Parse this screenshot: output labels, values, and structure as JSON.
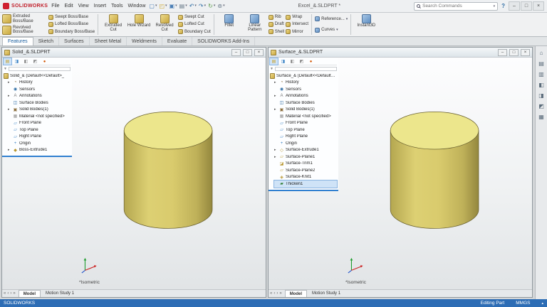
{
  "app": {
    "logo_text": "SOLIDWORKS",
    "menu": [
      "File",
      "Edit",
      "View",
      "Insert",
      "Tools",
      "Window"
    ],
    "qat": [
      {
        "name": "new-doc-icon",
        "glyph": "▢",
        "color": "#4a7eb5"
      },
      {
        "name": "open-icon",
        "glyph": "◰",
        "color": "#c9a227"
      },
      {
        "name": "save-icon",
        "glyph": "▣",
        "color": "#4a7eb5"
      },
      {
        "name": "print-icon",
        "glyph": "▤",
        "color": "#667788"
      },
      {
        "name": "undo-icon",
        "glyph": "↶",
        "color": "#2e6da4"
      },
      {
        "name": "redo-icon",
        "glyph": "↷",
        "color": "#2e6da4"
      },
      {
        "name": "rebuild-icon",
        "glyph": "↻",
        "color": "#5a9b4a"
      },
      {
        "name": "options-gear-icon",
        "glyph": "⊚",
        "color": "#667788"
      }
    ],
    "doc_title": "Excel_&.SLDPRT *",
    "search": {
      "placeholder": "Search Commands"
    },
    "help_label": "?",
    "window_buttons": {
      "minimize": "–",
      "maximize": "□",
      "close": "×"
    }
  },
  "ribbon": {
    "extruded_boss": "Extruded Boss/Base",
    "revolved_boss": "Revolved Boss/Base",
    "swept_boss": "Swept Boss/Base",
    "lofted_boss": "Lofted Boss/Base",
    "boundary_boss": "Boundary Boss/Base",
    "extruded_cut": "Extruded Cut",
    "hole_wizard": "Hole Wizard",
    "revolved_cut": "Revolved Cut",
    "swept_cut": "Swept Cut",
    "lofted_cut": "Lofted Cut",
    "boundary_cut": "Boundary Cut",
    "fillet": "Fillet",
    "linear_pattern": "Linear Pattern",
    "rib": "Rib",
    "draft": "Draft",
    "shell": "Shell",
    "wrap": "Wrap",
    "intersect": "Intersect",
    "mirror": "Mirror",
    "reference": "Reference...",
    "curves": "Curves",
    "instant3d": "Instant3D"
  },
  "tabs": [
    "Features",
    "Sketch",
    "Surfaces",
    "Sheet Metal",
    "Weldments",
    "Evaluate",
    "SOLIDWORKS Add-Ins"
  ],
  "panel_tabs": [
    {
      "name": "featuremanager-tab-icon",
      "glyph": "▤",
      "color": "#c9a227",
      "active": true
    },
    {
      "name": "propertymanager-tab-icon",
      "glyph": "◨",
      "color": "#3d84c6"
    },
    {
      "name": "configurationmanager-tab-icon",
      "glyph": "◧",
      "color": "#888888"
    },
    {
      "name": "dimxpertmanager-tab-icon",
      "glyph": "◩",
      "color": "#888888"
    },
    {
      "name": "displaymanager-tab-icon",
      "glyph": "●",
      "color": "#d35400"
    }
  ],
  "tab_nav": [
    {
      "name": "tab-scroll-first-icon",
      "glyph": "«"
    },
    {
      "name": "tab-scroll-prev-icon",
      "glyph": "‹"
    },
    {
      "name": "tab-scroll-next-icon",
      "glyph": "›"
    },
    {
      "name": "tab-scroll-last-icon",
      "glyph": "»"
    }
  ],
  "taskpane": [
    {
      "name": "home-icon",
      "glyph": "⌂"
    },
    {
      "name": "design-library-icon",
      "glyph": "▤"
    },
    {
      "name": "file-explorer-icon",
      "glyph": "▥"
    },
    {
      "name": "view-palette-icon",
      "glyph": "◧"
    },
    {
      "name": "appearances-icon",
      "glyph": "◨"
    },
    {
      "name": "scene-icon",
      "glyph": "◩"
    },
    {
      "name": "custom-properties-icon",
      "glyph": "▦"
    }
  ],
  "windows": [
    {
      "title": "Solid_&.SLDPRT",
      "root": "Solid_& (Default<<Default>_",
      "view_label": "*Isometric",
      "model_tab": "Model",
      "motion_tab": "Motion Study 1",
      "tree": [
        {
          "arrow": "▸",
          "glyph": "◔",
          "color": "#8a6d3b",
          "label": "History"
        },
        {
          "arrow": "",
          "glyph": "◉",
          "color": "#2e6da4",
          "label": "Sensors"
        },
        {
          "arrow": "▸",
          "glyph": "A",
          "color": "#777777",
          "label": "Annotations"
        },
        {
          "arrow": "",
          "glyph": "◫",
          "color": "#2e6da4",
          "label": "Surface Bodies"
        },
        {
          "arrow": "▸",
          "glyph": "▣",
          "color": "#8a6d3b",
          "label": "Solid Bodies(1)"
        },
        {
          "arrow": "",
          "glyph": "▦",
          "color": "#999999",
          "label": "Material <not specified>"
        },
        {
          "arrow": "",
          "glyph": "▱",
          "color": "#3d84c6",
          "label": "Front Plane"
        },
        {
          "arrow": "",
          "glyph": "▱",
          "color": "#3d84c6",
          "label": "Top Plane"
        },
        {
          "arrow": "",
          "glyph": "▱",
          "color": "#3d84c6",
          "label": "Right Plane"
        },
        {
          "arrow": "",
          "glyph": "+",
          "color": "#3d84c6",
          "label": "Origin"
        },
        {
          "arrow": "▸",
          "glyph": "◆",
          "color": "#b8962e",
          "label": "Boss-Extrude1"
        }
      ]
    },
    {
      "title": "Surface_&.SLDPRT",
      "root": "Surface_& (Default<<Default>_Disp",
      "view_label": "*Isometric",
      "model_tab": "Model",
      "motion_tab": "Motion Study 1",
      "tree": [
        {
          "arrow": "▸",
          "glyph": "◔",
          "color": "#8a6d3b",
          "label": "History"
        },
        {
          "arrow": "",
          "glyph": "◉",
          "color": "#2e6da4",
          "label": "Sensors"
        },
        {
          "arrow": "▸",
          "glyph": "A",
          "color": "#777777",
          "label": "Annotations"
        },
        {
          "arrow": "",
          "glyph": "◫",
          "color": "#2e6da4",
          "label": "Surface Bodies"
        },
        {
          "arrow": "▸",
          "glyph": "▣",
          "color": "#8a6d3b",
          "label": "Solid Bodies(1)"
        },
        {
          "arrow": "",
          "glyph": "▦",
          "color": "#999999",
          "label": "Material <not specified>"
        },
        {
          "arrow": "",
          "glyph": "▱",
          "color": "#3d84c6",
          "label": "Front Plane"
        },
        {
          "arrow": "",
          "glyph": "▱",
          "color": "#3d84c6",
          "label": "Top Plane"
        },
        {
          "arrow": "",
          "glyph": "▱",
          "color": "#3d84c6",
          "label": "Right Plane"
        },
        {
          "arrow": "",
          "glyph": "+",
          "color": "#3d84c6",
          "label": "Origin"
        },
        {
          "arrow": "▸",
          "glyph": "◇",
          "color": "#b8962e",
          "label": "Surface-Extrude1"
        },
        {
          "arrow": "▸",
          "glyph": "▱",
          "color": "#b8962e",
          "label": "Surface-Plane1"
        },
        {
          "arrow": "",
          "glyph": "◪",
          "color": "#b8962e",
          "label": "Surface-Trim1"
        },
        {
          "arrow": "",
          "glyph": "▱",
          "color": "#b8962e",
          "label": "Surface-Plane2"
        },
        {
          "arrow": "",
          "glyph": "◈",
          "color": "#b8962e",
          "label": "Surface-Knit1"
        },
        {
          "arrow": "",
          "glyph": "▰",
          "color": "#2e7d32",
          "label": "Thicken1",
          "selected": true
        }
      ]
    }
  ],
  "statusbar": {
    "brand": "SOLIDWORKS",
    "editing": "Editing Part",
    "units": "MMGS"
  }
}
